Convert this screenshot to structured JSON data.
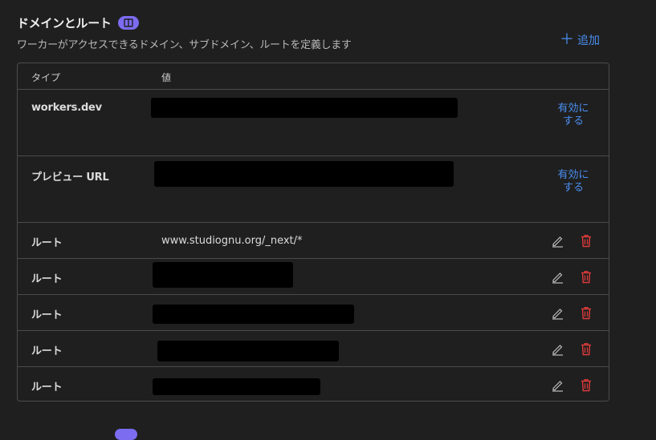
{
  "section": {
    "title": "ドメインとルート",
    "subtitle": "ワーカーがアクセスできるドメイン、サブドメイン、ルートを定義します",
    "add_label": "追加"
  },
  "table": {
    "columns": {
      "type": "タイプ",
      "value": "値"
    },
    "enable_label": "有効にする",
    "rows": [
      {
        "type": "workers.dev",
        "value": "",
        "redacted": true
      },
      {
        "type": "プレビュー URL",
        "value": "",
        "redacted": true
      },
      {
        "type": "ルート",
        "value": "www.studiognu.org/_next/*",
        "redacted": false
      },
      {
        "type": "ルート",
        "value": "",
        "redacted": true
      },
      {
        "type": "ルート",
        "value": "",
        "redacted": true
      },
      {
        "type": "ルート",
        "value": "",
        "redacted": true
      },
      {
        "type": "ルート",
        "value": "",
        "redacted": true
      }
    ]
  },
  "colors": {
    "background": "#1f1f1f",
    "accent_blue": "#4a8ef0",
    "badge_purple": "#7b6cf0",
    "delete_red": "#e03c3c",
    "border": "#4b4b4b"
  },
  "icons": [
    "book-icon",
    "plus-icon",
    "edit-icon",
    "trash-icon"
  ]
}
